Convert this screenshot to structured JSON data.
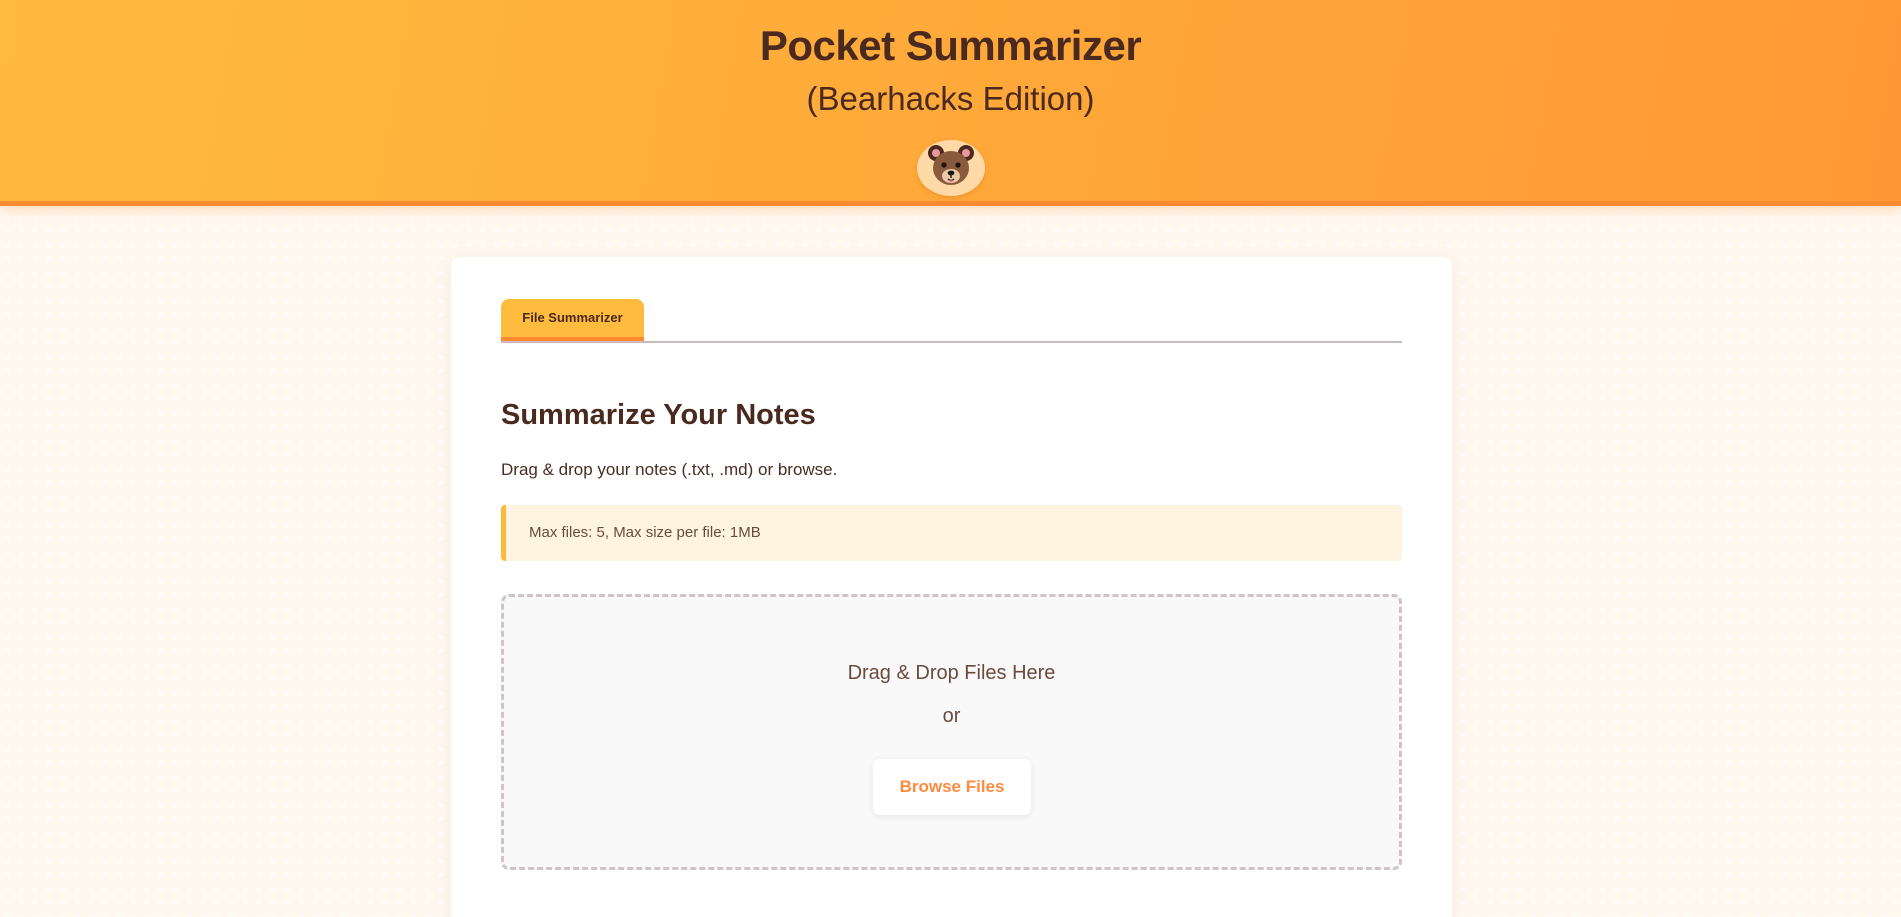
{
  "header": {
    "title": "Pocket Summarizer",
    "subtitle": "(Bearhacks Edition)",
    "logo_icon": "bear-face-icon"
  },
  "tabs": [
    {
      "label": "File Summarizer",
      "active": true
    }
  ],
  "main": {
    "heading": "Summarize Your Notes",
    "description": "Drag & drop your notes (.txt, .md) or browse.",
    "notice": "Max files: 5, Max size per file: 1MB",
    "dropzone": {
      "prompt": "Drag & Drop Files Here",
      "or_label": "or",
      "browse_label": "Browse Files"
    }
  },
  "colors": {
    "header_start": "#ffbb3d",
    "header_end": "#ff9834",
    "accent": "#ff8a2f",
    "text_dark": "#4a2a1e",
    "notice_bg": "#fff4df",
    "button_text": "#ff8a3d"
  }
}
